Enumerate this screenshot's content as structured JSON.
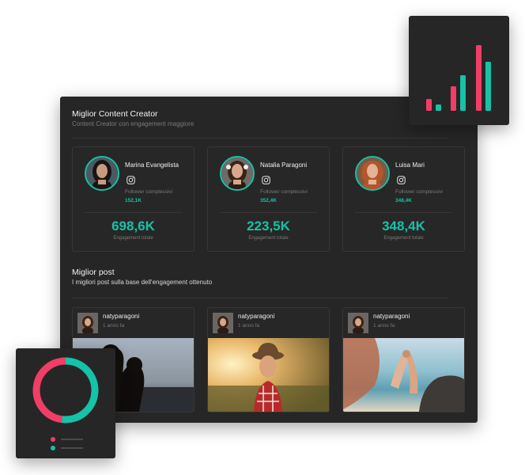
{
  "creators_section": {
    "title": "Miglior Content Creator",
    "subtitle": "Content Creator con engagement maggiore"
  },
  "creators": [
    {
      "name": "Marina Evangelista",
      "follower_label": "Follower complessivi",
      "follower_value": "152,1K",
      "engagement_value": "698,6K",
      "engagement_label": "Engagement totale"
    },
    {
      "name": "Natalia Paragoni",
      "follower_label": "Follower complessivi",
      "follower_value": "352,4K",
      "engagement_value": "223,5K",
      "engagement_label": "Engagement totale"
    },
    {
      "name": "Luisa Mari",
      "follower_label": "Follower complessivi",
      "follower_value": "348,4K",
      "engagement_value": "348,4K",
      "engagement_label": "Engagement totale"
    }
  ],
  "posts_section": {
    "title": "Miglior post",
    "subtitle": "I migliori post sulla base dell'engagement ottenuto"
  },
  "posts": [
    {
      "username": "natyparagoni",
      "time": "1 anno fa"
    },
    {
      "username": "natyparagoni",
      "time": "1 anno fa"
    },
    {
      "username": "natyparagoni",
      "time": "1 anno fa"
    }
  ],
  "colors": {
    "teal": "#16c2a8",
    "pink": "#f03e66",
    "panel": "#262626"
  },
  "bar_widget": {
    "bars": [
      {
        "color": "pink",
        "level": 0.15
      },
      {
        "color": "teal",
        "level": 0.08
      },
      {
        "color": "pink",
        "level": 0.31
      },
      {
        "color": "teal",
        "level": 0.45
      },
      {
        "color": "pink",
        "level": 0.83
      },
      {
        "color": "teal",
        "level": 0.62
      }
    ]
  },
  "donut_widget": {
    "segments": [
      {
        "color": "teal",
        "fraction": 0.52
      },
      {
        "color": "pink",
        "fraction": 0.48
      }
    ]
  }
}
